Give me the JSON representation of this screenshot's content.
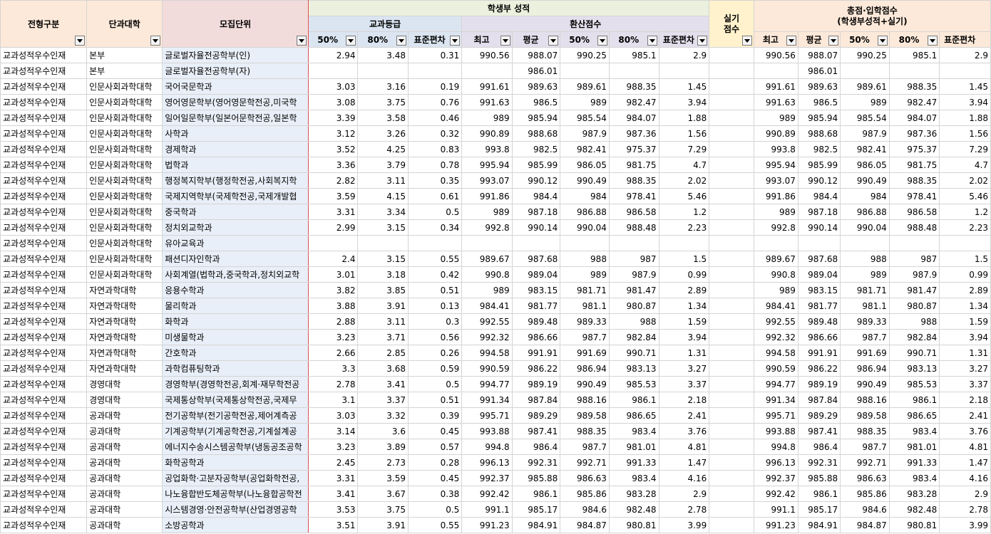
{
  "headers": {
    "selection_type": "전형구분",
    "college": "단과대학",
    "unit": "모집단위",
    "student_record": "학생부 성적",
    "subject_grade": "교과등급",
    "converted_score": "환산점수",
    "practical": "실기\n점수",
    "total": "총점·입학점수\n(학생부성적+실기)",
    "g50": "50%",
    "g80": "80%",
    "gstd": "표준편차",
    "cmax": "최고",
    "cavg": "평균",
    "c50": "50%",
    "c80": "80%",
    "cstd": "표준편차",
    "tmax": "최고",
    "tavg": "평균",
    "t50": "50%",
    "t80": "80%",
    "tstd": "표준편차"
  },
  "rows": [
    [
      "교과성적우수인재",
      "본부",
      "글로벌자율전공학부(인)",
      "2.94",
      "3.48",
      "0.31",
      "990.56",
      "988.07",
      "990.25",
      "985.1",
      "2.9",
      "",
      "990.56",
      "988.07",
      "990.25",
      "985.1",
      "2.9"
    ],
    [
      "교과성적우수인재",
      "본부",
      "글로벌자율전공학부(자)",
      "",
      "",
      "",
      "",
      "986.01",
      "",
      "",
      "",
      "",
      "",
      "986.01",
      "",
      "",
      ""
    ],
    [
      "교과성적우수인재",
      "인문사회과학대학",
      "국어국문학과",
      "3.03",
      "3.16",
      "0.19",
      "991.61",
      "989.63",
      "989.61",
      "988.35",
      "1.45",
      "",
      "991.61",
      "989.63",
      "989.61",
      "988.35",
      "1.45"
    ],
    [
      "교과성적우수인재",
      "인문사회과학대학",
      "영어영문학부(영어영문학전공,미국학",
      "3.08",
      "3.75",
      "0.76",
      "991.63",
      "986.5",
      "989",
      "982.47",
      "3.94",
      "",
      "991.63",
      "986.5",
      "989",
      "982.47",
      "3.94"
    ],
    [
      "교과성적우수인재",
      "인문사회과학대학",
      "일어일문학부(일본어문학전공,일본학",
      "3.39",
      "3.58",
      "0.46",
      "989",
      "985.94",
      "985.54",
      "984.07",
      "1.88",
      "",
      "989",
      "985.94",
      "985.54",
      "984.07",
      "1.88"
    ],
    [
      "교과성적우수인재",
      "인문사회과학대학",
      "사학과",
      "3.12",
      "3.26",
      "0.32",
      "990.89",
      "988.68",
      "987.9",
      "987.36",
      "1.56",
      "",
      "990.89",
      "988.68",
      "987.9",
      "987.36",
      "1.56"
    ],
    [
      "교과성적우수인재",
      "인문사회과학대학",
      "경제학과",
      "3.52",
      "4.25",
      "0.83",
      "993.8",
      "982.5",
      "982.41",
      "975.37",
      "7.29",
      "",
      "993.8",
      "982.5",
      "982.41",
      "975.37",
      "7.29"
    ],
    [
      "교과성적우수인재",
      "인문사회과학대학",
      "법학과",
      "3.36",
      "3.79",
      "0.78",
      "995.94",
      "985.99",
      "986.05",
      "981.75",
      "4.7",
      "",
      "995.94",
      "985.99",
      "986.05",
      "981.75",
      "4.7"
    ],
    [
      "교과성적우수인재",
      "인문사회과학대학",
      "행정복지학부(행정학전공,사회복지학",
      "2.82",
      "3.11",
      "0.35",
      "993.07",
      "990.12",
      "990.49",
      "988.35",
      "2.02",
      "",
      "993.07",
      "990.12",
      "990.49",
      "988.35",
      "2.02"
    ],
    [
      "교과성적우수인재",
      "인문사회과학대학",
      "국제지역학부(국제학전공,국제개발협",
      "3.59",
      "4.15",
      "0.61",
      "991.86",
      "984.4",
      "984",
      "978.41",
      "5.46",
      "",
      "991.86",
      "984.4",
      "984",
      "978.41",
      "5.46"
    ],
    [
      "교과성적우수인재",
      "인문사회과학대학",
      "중국학과",
      "3.31",
      "3.34",
      "0.5",
      "989",
      "987.18",
      "986.88",
      "986.58",
      "1.2",
      "",
      "989",
      "987.18",
      "986.88",
      "986.58",
      "1.2"
    ],
    [
      "교과성적우수인재",
      "인문사회과학대학",
      "정치외교학과",
      "2.99",
      "3.15",
      "0.34",
      "992.8",
      "990.14",
      "990.04",
      "988.48",
      "2.23",
      "",
      "992.8",
      "990.14",
      "990.04",
      "988.48",
      "2.23"
    ],
    [
      "교과성적우수인재",
      "인문사회과학대학",
      "유아교육과",
      "",
      "",
      "",
      "",
      "",
      "",
      "",
      "",
      "",
      "",
      "",
      "",
      "",
      ""
    ],
    [
      "교과성적우수인재",
      "인문사회과학대학",
      "패션디자인학과",
      "2.4",
      "3.15",
      "0.55",
      "989.67",
      "987.68",
      "988",
      "987",
      "1.5",
      "",
      "989.67",
      "987.68",
      "988",
      "987",
      "1.5"
    ],
    [
      "교과성적우수인재",
      "인문사회과학대학",
      "사회계열(법학과,중국학과,정치외교학",
      "3.01",
      "3.18",
      "0.42",
      "990.8",
      "989.04",
      "989",
      "987.9",
      "0.99",
      "",
      "990.8",
      "989.04",
      "989",
      "987.9",
      "0.99"
    ],
    [
      "교과성적우수인재",
      "자연과학대학",
      "응용수학과",
      "3.82",
      "3.85",
      "0.51",
      "989",
      "983.15",
      "981.71",
      "981.47",
      "2.89",
      "",
      "989",
      "983.15",
      "981.71",
      "981.47",
      "2.89"
    ],
    [
      "교과성적우수인재",
      "자연과학대학",
      "물리학과",
      "3.88",
      "3.91",
      "0.13",
      "984.41",
      "981.77",
      "981.1",
      "980.87",
      "1.34",
      "",
      "984.41",
      "981.77",
      "981.1",
      "980.87",
      "1.34"
    ],
    [
      "교과성적우수인재",
      "자연과학대학",
      "화학과",
      "2.88",
      "3.11",
      "0.3",
      "992.55",
      "989.48",
      "989.33",
      "988",
      "1.59",
      "",
      "992.55",
      "989.48",
      "989.33",
      "988",
      "1.59"
    ],
    [
      "교과성적우수인재",
      "자연과학대학",
      "미생물학과",
      "3.23",
      "3.71",
      "0.56",
      "992.32",
      "986.66",
      "987.7",
      "982.84",
      "3.94",
      "",
      "992.32",
      "986.66",
      "987.7",
      "982.84",
      "3.94"
    ],
    [
      "교과성적우수인재",
      "자연과학대학",
      "간호학과",
      "2.66",
      "2.85",
      "0.26",
      "994.58",
      "991.91",
      "991.69",
      "990.71",
      "1.31",
      "",
      "994.58",
      "991.91",
      "991.69",
      "990.71",
      "1.31"
    ],
    [
      "교과성적우수인재",
      "자연과학대학",
      "과학컴퓨팅학과",
      "3.3",
      "3.68",
      "0.59",
      "990.59",
      "986.22",
      "986.94",
      "983.13",
      "3.27",
      "",
      "990.59",
      "986.22",
      "986.94",
      "983.13",
      "3.27"
    ],
    [
      "교과성적우수인재",
      "경영대학",
      "경영학부(경영학전공,회계·재무학전공",
      "2.78",
      "3.41",
      "0.5",
      "994.77",
      "989.19",
      "990.49",
      "985.53",
      "3.37",
      "",
      "994.77",
      "989.19",
      "990.49",
      "985.53",
      "3.37"
    ],
    [
      "교과성적우수인재",
      "경영대학",
      "국제통상학부(국제통상학전공,국제무",
      "3.1",
      "3.37",
      "0.51",
      "991.34",
      "987.84",
      "988.16",
      "986.1",
      "2.18",
      "",
      "991.34",
      "987.84",
      "988.16",
      "986.1",
      "2.18"
    ],
    [
      "교과성적우수인재",
      "공과대학",
      "전기공학부(전기공학전공,제어계측공",
      "3.03",
      "3.32",
      "0.39",
      "995.71",
      "989.29",
      "989.58",
      "986.65",
      "2.41",
      "",
      "995.71",
      "989.29",
      "989.58",
      "986.65",
      "2.41"
    ],
    [
      "교과성적우수인재",
      "공과대학",
      "기계공학부(기계공학전공,기계설계공",
      "3.14",
      "3.6",
      "0.45",
      "993.88",
      "987.41",
      "988.35",
      "983.4",
      "3.76",
      "",
      "993.88",
      "987.41",
      "988.35",
      "983.4",
      "3.76"
    ],
    [
      "교과성적우수인재",
      "공과대학",
      "에너지수송시스템공학부(냉동공조공학",
      "3.23",
      "3.89",
      "0.57",
      "994.8",
      "986.4",
      "987.7",
      "981.01",
      "4.81",
      "",
      "994.8",
      "986.4",
      "987.7",
      "981.01",
      "4.81"
    ],
    [
      "교과성적우수인재",
      "공과대학",
      "화학공학과",
      "2.45",
      "2.73",
      "0.28",
      "996.13",
      "992.31",
      "992.71",
      "991.33",
      "1.47",
      "",
      "996.13",
      "992.31",
      "992.71",
      "991.33",
      "1.47"
    ],
    [
      "교과성적우수인재",
      "공과대학",
      "공업화학·고분자공학부(공업화학전공,",
      "3.31",
      "3.59",
      "0.45",
      "992.37",
      "985.88",
      "986.63",
      "983.4",
      "4.16",
      "",
      "992.37",
      "985.88",
      "986.63",
      "983.4",
      "4.16"
    ],
    [
      "교과성적우수인재",
      "공과대학",
      "나노융합반도체공학부(나노융합공학전",
      "3.41",
      "3.67",
      "0.38",
      "992.42",
      "986.1",
      "985.86",
      "983.28",
      "2.9",
      "",
      "992.42",
      "986.1",
      "985.86",
      "983.28",
      "2.9"
    ],
    [
      "교과성적우수인재",
      "공과대학",
      "시스템경영·안전공학부(산업경영공학",
      "3.53",
      "3.75",
      "0.5",
      "991.1",
      "985.17",
      "984.6",
      "982.48",
      "2.78",
      "",
      "991.1",
      "985.17",
      "984.6",
      "982.48",
      "2.78"
    ],
    [
      "교과성적우수인재",
      "공과대학",
      "소방공학과",
      "3.51",
      "3.91",
      "0.55",
      "991.23",
      "984.91",
      "984.87",
      "980.81",
      "3.99",
      "",
      "991.23",
      "984.91",
      "984.87",
      "980.81",
      "3.99"
    ]
  ]
}
